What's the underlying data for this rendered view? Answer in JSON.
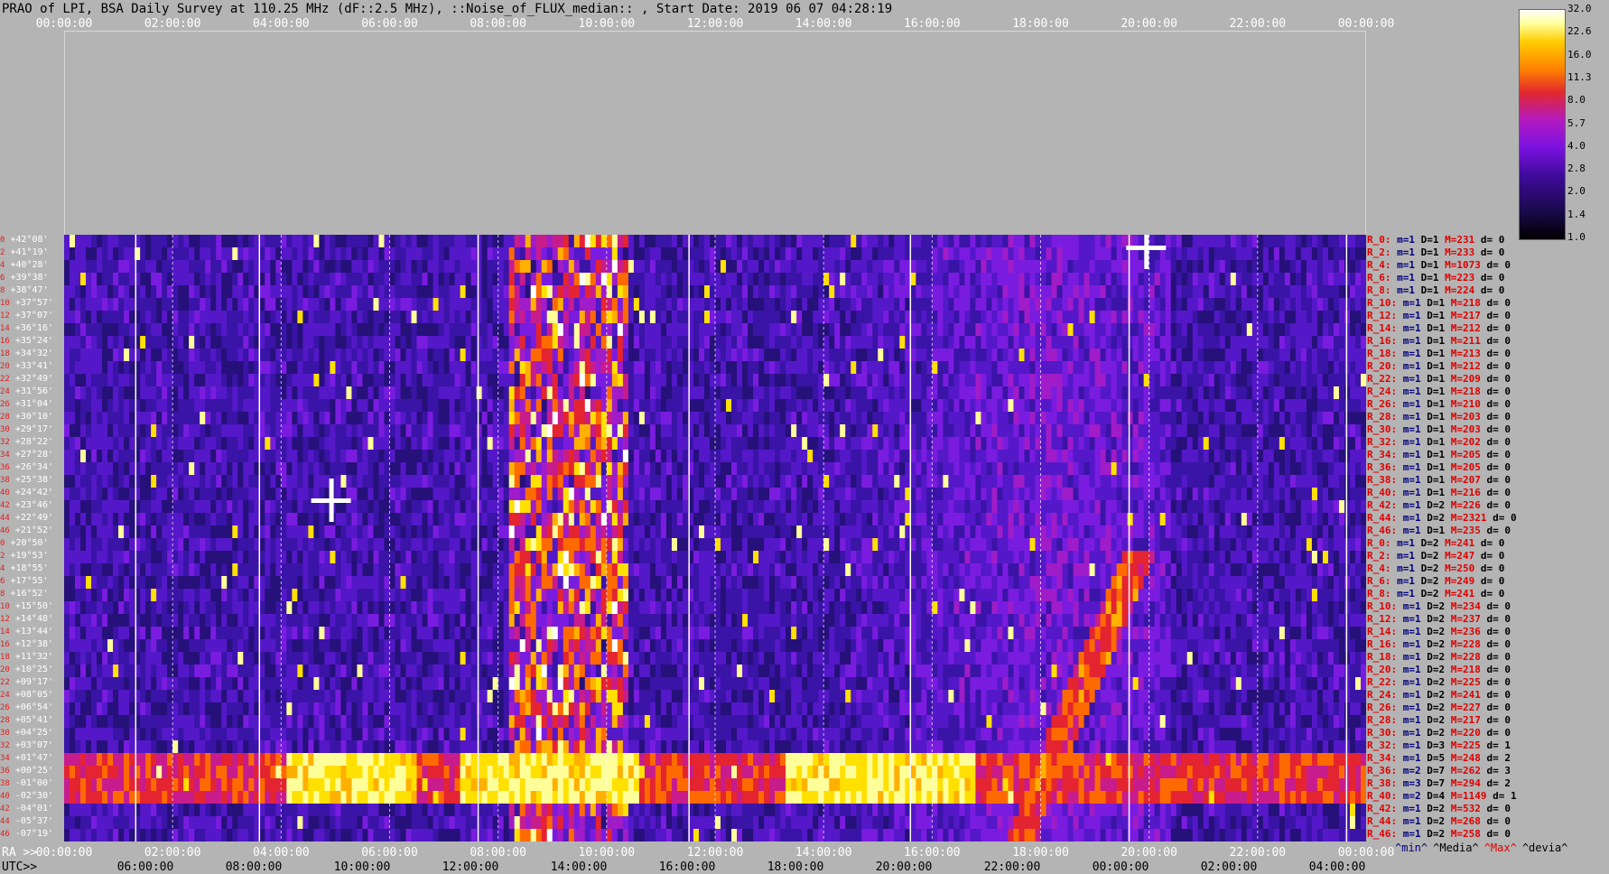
{
  "title": "PRAO of LPI, BSA Daily Survey at 110.25 MHz (dF::2.5 MHz), ::Noise_of_FLUX_median:: , Start Date: 2019 06 07 04:28:19",
  "chart_data": {
    "type": "heatmap",
    "title": "PRAO of LPI, BSA Daily Survey at 110.25 MHz (dF::2.5 MHz), ::Noise_of_FLUX_median:: , Start Date: 2019 06 07 04:28:19",
    "top_axis_ticks": [
      "00:00:00",
      "02:00:00",
      "04:00:00",
      "06:00:00",
      "08:00:00",
      "10:00:00",
      "12:00:00",
      "14:00:00",
      "16:00:00",
      "18:00:00",
      "20:00:00",
      "22:00:00",
      "00:00:00"
    ],
    "ra_axis_prefix": "RA >>",
    "ra_axis_ticks": [
      "00:00:00",
      "02:00:00",
      "04:00:00",
      "06:00:00",
      "08:00:00",
      "10:00:00",
      "12:00:00",
      "14:00:00",
      "16:00:00",
      "18:00:00",
      "20:00:00",
      "22:00:00",
      "00:00:00"
    ],
    "utc_axis_prefix": "UTC>>",
    "utc_axis_ticks": [
      "06:00:00",
      "08:00:00",
      "10:00:00",
      "12:00:00",
      "14:00:00",
      "16:00:00",
      "18:00:00",
      "20:00:00",
      "22:00:00",
      "00:00:00",
      "02:00:00",
      "04:00:00"
    ],
    "colorbar_ticks": [
      "32.0",
      "22.6",
      "16.0",
      "11.3",
      "8.0",
      "5.7",
      "4.0",
      "2.8",
      "2.0",
      "1.4",
      "1.0"
    ],
    "declinations": [
      "+42°08'",
      "+41°19'",
      "+40°28'",
      "+39°38'",
      "+38°47'",
      "+37°57'",
      "+37°07'",
      "+36°16'",
      "+35°24'",
      "+34°32'",
      "+33°41'",
      "+32°49'",
      "+31°56'",
      "+31°04'",
      "+30°10'",
      "+29°17'",
      "+28°22'",
      "+27°28'",
      "+26°34'",
      "+25°38'",
      "+24°42'",
      "+23°46'",
      "+22°49'",
      "+21°52'",
      "+20°50'",
      "+19°53'",
      "+18°55'",
      "+17°55'",
      "+16°52'",
      "+15°50'",
      "+14°48'",
      "+13°44'",
      "+12°38'",
      "+11°32'",
      "+10°25'",
      "+09°17'",
      "+08°05'",
      "+06°54'",
      "+05°41'",
      "+04°25'",
      "+03°07'",
      "+01°47'",
      "+00°25'",
      "-01°00'",
      "-02°30'",
      "-04°01'",
      "-05°37'",
      "-07°19'"
    ],
    "row_indices": [
      "0",
      "2",
      "4",
      "6",
      "8",
      "10",
      "12",
      "14",
      "16",
      "18",
      "20",
      "22",
      "24",
      "26",
      "28",
      "30",
      "32",
      "34",
      "36",
      "38",
      "40",
      "42",
      "44",
      "46",
      "0",
      "2",
      "4",
      "6",
      "8",
      "10",
      "12",
      "14",
      "16",
      "18",
      "20",
      "22",
      "24",
      "26",
      "28",
      "30",
      "32",
      "34",
      "36",
      "38",
      "40",
      "42",
      "44",
      "46"
    ],
    "row_stats": [
      {
        "r": "R_0:",
        "m": "m=1",
        "d": "D=1",
        "h": "M=231",
        "dv": "d= 0"
      },
      {
        "r": "R_2:",
        "m": "m=1",
        "d": "D=1",
        "h": "M=233",
        "dv": "d= 0"
      },
      {
        "r": "R_4:",
        "m": "m=1",
        "d": "D=1",
        "h": "M=1073",
        "dv": "d= 0"
      },
      {
        "r": "R_6:",
        "m": "m=1",
        "d": "D=1",
        "h": "M=223",
        "dv": "d= 0"
      },
      {
        "r": "R_8:",
        "m": "m=1",
        "d": "D=1",
        "h": "M=224",
        "dv": "d= 0"
      },
      {
        "r": "R_10:",
        "m": "m=1",
        "d": "D=1",
        "h": "M=218",
        "dv": "d= 0"
      },
      {
        "r": "R_12:",
        "m": "m=1",
        "d": "D=1",
        "h": "M=217",
        "dv": "d= 0"
      },
      {
        "r": "R_14:",
        "m": "m=1",
        "d": "D=1",
        "h": "M=212",
        "dv": "d= 0"
      },
      {
        "r": "R_16:",
        "m": "m=1",
        "d": "D=1",
        "h": "M=211",
        "dv": "d= 0"
      },
      {
        "r": "R_18:",
        "m": "m=1",
        "d": "D=1",
        "h": "M=213",
        "dv": "d= 0"
      },
      {
        "r": "R_20:",
        "m": "m=1",
        "d": "D=1",
        "h": "M=212",
        "dv": "d= 0"
      },
      {
        "r": "R_22:",
        "m": "m=1",
        "d": "D=1",
        "h": "M=209",
        "dv": "d= 0"
      },
      {
        "r": "R_24:",
        "m": "m=1",
        "d": "D=1",
        "h": "M=218",
        "dv": "d= 0"
      },
      {
        "r": "R_26:",
        "m": "m=1",
        "d": "D=1",
        "h": "M=210",
        "dv": "d= 0"
      },
      {
        "r": "R_28:",
        "m": "m=1",
        "d": "D=1",
        "h": "M=203",
        "dv": "d= 0"
      },
      {
        "r": "R_30:",
        "m": "m=1",
        "d": "D=1",
        "h": "M=203",
        "dv": "d= 0"
      },
      {
        "r": "R_32:",
        "m": "m=1",
        "d": "D=1",
        "h": "M=202",
        "dv": "d= 0"
      },
      {
        "r": "R_34:",
        "m": "m=1",
        "d": "D=1",
        "h": "M=205",
        "dv": "d= 0"
      },
      {
        "r": "R_36:",
        "m": "m=1",
        "d": "D=1",
        "h": "M=205",
        "dv": "d= 0"
      },
      {
        "r": "R_38:",
        "m": "m=1",
        "d": "D=1",
        "h": "M=207",
        "dv": "d= 0"
      },
      {
        "r": "R_40:",
        "m": "m=1",
        "d": "D=1",
        "h": "M=216",
        "dv": "d= 0"
      },
      {
        "r": "R_42:",
        "m": "m=1",
        "d": "D=2",
        "h": "M=226",
        "dv": "d= 0"
      },
      {
        "r": "R_44:",
        "m": "m=1",
        "d": "D=2",
        "h": "M=2321",
        "dv": "d= 0"
      },
      {
        "r": "R_46:",
        "m": "m=1",
        "d": "D=1",
        "h": "M=235",
        "dv": "d= 0"
      },
      {
        "r": "R_0:",
        "m": "m=1",
        "d": "D=2",
        "h": "M=241",
        "dv": "d= 0"
      },
      {
        "r": "R_2:",
        "m": "m=1",
        "d": "D=2",
        "h": "M=247",
        "dv": "d= 0"
      },
      {
        "r": "R_4:",
        "m": "m=1",
        "d": "D=2",
        "h": "M=250",
        "dv": "d= 0"
      },
      {
        "r": "R_6:",
        "m": "m=1",
        "d": "D=2",
        "h": "M=249",
        "dv": "d= 0"
      },
      {
        "r": "R_8:",
        "m": "m=1",
        "d": "D=2",
        "h": "M=241",
        "dv": "d= 0"
      },
      {
        "r": "R_10:",
        "m": "m=1",
        "d": "D=2",
        "h": "M=234",
        "dv": "d= 0"
      },
      {
        "r": "R_12:",
        "m": "m=1",
        "d": "D=2",
        "h": "M=237",
        "dv": "d= 0"
      },
      {
        "r": "R_14:",
        "m": "m=1",
        "d": "D=2",
        "h": "M=236",
        "dv": "d= 0"
      },
      {
        "r": "R_16:",
        "m": "m=1",
        "d": "D=2",
        "h": "M=228",
        "dv": "d= 0"
      },
      {
        "r": "R_18:",
        "m": "m=1",
        "d": "D=2",
        "h": "M=228",
        "dv": "d= 0"
      },
      {
        "r": "R_20:",
        "m": "m=1",
        "d": "D=2",
        "h": "M=218",
        "dv": "d= 0"
      },
      {
        "r": "R_22:",
        "m": "m=1",
        "d": "D=2",
        "h": "M=225",
        "dv": "d= 0"
      },
      {
        "r": "R_24:",
        "m": "m=1",
        "d": "D=2",
        "h": "M=241",
        "dv": "d= 0"
      },
      {
        "r": "R_26:",
        "m": "m=1",
        "d": "D=2",
        "h": "M=227",
        "dv": "d= 0"
      },
      {
        "r": "R_28:",
        "m": "m=1",
        "d": "D=2",
        "h": "M=217",
        "dv": "d= 0"
      },
      {
        "r": "R_30:",
        "m": "m=1",
        "d": "D=2",
        "h": "M=220",
        "dv": "d= 0"
      },
      {
        "r": "R_32:",
        "m": "m=1",
        "d": "D=3",
        "h": "M=225",
        "dv": "d= 1"
      },
      {
        "r": "R_34:",
        "m": "m=1",
        "d": "D=5",
        "h": "M=248",
        "dv": "d= 2"
      },
      {
        "r": "R_36:",
        "m": "m=2",
        "d": "D=7",
        "h": "M=262",
        "dv": "d= 3"
      },
      {
        "r": "R_38:",
        "m": "m=3",
        "d": "D=7",
        "h": "M=294",
        "dv": "d= 2"
      },
      {
        "r": "R_40:",
        "m": "m=2",
        "d": "D=4",
        "h": "M=1149",
        "dv": "d= 1"
      },
      {
        "r": "R_42:",
        "m": "m=1",
        "d": "D=2",
        "h": "M=532",
        "dv": "d= 0"
      },
      {
        "r": "R_44:",
        "m": "m=1",
        "d": "D=2",
        "h": "M=268",
        "dv": "d= 0"
      },
      {
        "r": "R_46:",
        "m": "m=1",
        "d": "D=2",
        "h": "M=258",
        "dv": "d= 0"
      }
    ],
    "legend": [
      "^min^",
      "^Media^",
      "^Max^",
      "^devia^"
    ],
    "legend_colors": [
      "#00007c",
      "#000000",
      "#e00000",
      "#000000"
    ]
  }
}
